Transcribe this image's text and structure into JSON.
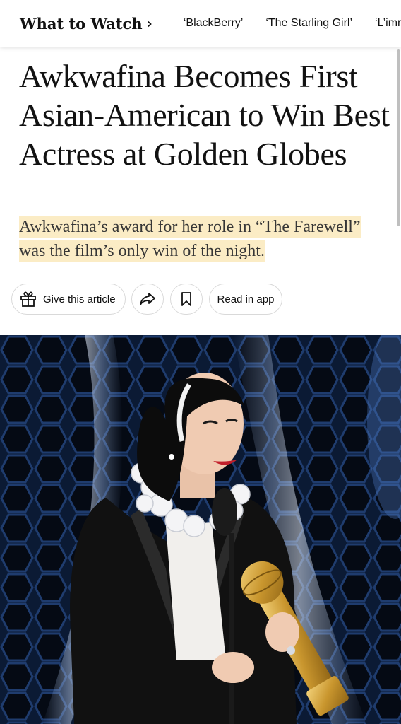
{
  "nav": {
    "title": "What to Watch",
    "chevron": "›",
    "links": [
      "‘BlackBerry’",
      "‘The Starling Girl’",
      "‘L’immensità’"
    ]
  },
  "article": {
    "headline": "Awkwafina Becomes First Asian-American to Win Best Actress at Golden Globes",
    "summary": "Awkwafina’s award for her role in “The Farewell” was the film’s only win of the night."
  },
  "actions": {
    "gift_label": "Give this article",
    "read_in_app_label": "Read in app",
    "icons": [
      "gift-icon",
      "share-icon",
      "bookmark-icon"
    ]
  },
  "colors": {
    "summary_highlight": "#fbecc5",
    "photo_background": "#0c1d3a"
  }
}
